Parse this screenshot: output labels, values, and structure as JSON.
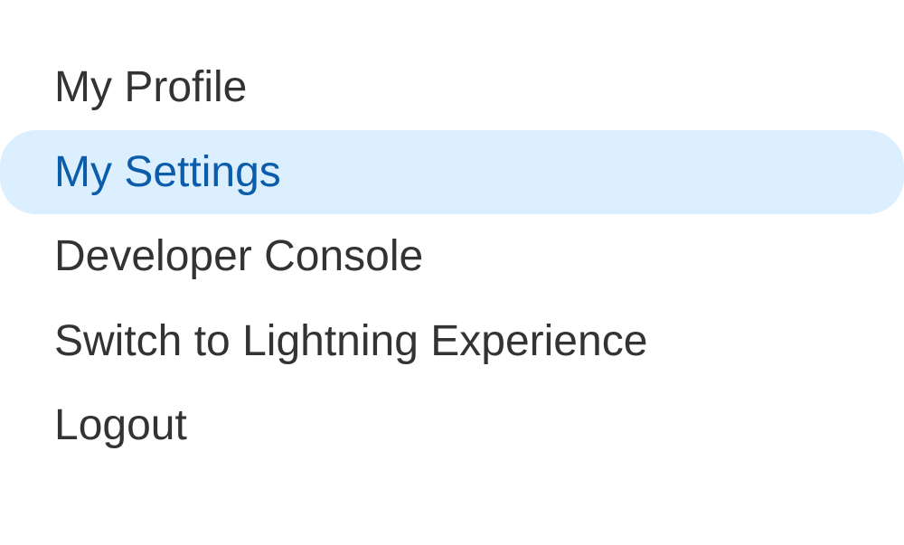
{
  "menu": {
    "items": [
      {
        "label": "My Profile",
        "highlighted": false
      },
      {
        "label": "My Settings",
        "highlighted": true
      },
      {
        "label": "Developer Console",
        "highlighted": false
      },
      {
        "label": "Switch to Lightning Experience",
        "highlighted": false
      },
      {
        "label": "Logout",
        "highlighted": false
      }
    ]
  },
  "colors": {
    "highlight_bg": "#dcefff",
    "highlight_text": "#0b5cab",
    "text": "#333333"
  }
}
